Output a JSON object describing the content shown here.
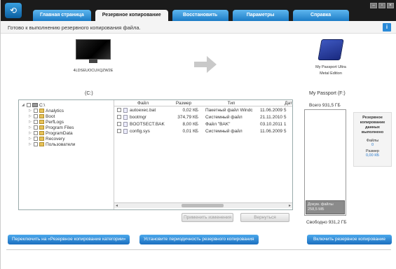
{
  "nav": {
    "tabs": [
      {
        "label": "Главная страница"
      },
      {
        "label": "Резервное копирование"
      },
      {
        "label": "Восстановить"
      },
      {
        "label": "Параметры"
      },
      {
        "label": "Справка"
      }
    ]
  },
  "status": {
    "text": "Готово к выполнению резервного копирования файла."
  },
  "info_icon": {
    "glyph": "i"
  },
  "source": {
    "device_name": "4LDSEUOCUXQZW2E",
    "drive_label": "(C:)"
  },
  "destination": {
    "device_name_line1": "My Passport Ultra",
    "device_name_line2": "Metal Edition",
    "drive_label": "My Passport (F:)"
  },
  "tree": {
    "root": "C:\\",
    "folders": [
      "Analytics",
      "Boot",
      "PerfLogs",
      "Program Files",
      "ProgramData",
      "Recovery",
      "Пользователи"
    ]
  },
  "files": {
    "columns": [
      "Файл",
      "Размер",
      "Тип",
      "Дат"
    ],
    "rows": [
      {
        "name": "autoexec.bat",
        "size": "0,02 КБ",
        "type": "Пакетный файл Windc",
        "date": "11.06.2009 5"
      },
      {
        "name": "bootmgr",
        "size": "374,79 КБ",
        "type": "Системный файл",
        "date": "21.11.2010 5"
      },
      {
        "name": "BOOTSECT.BAK",
        "size": "8,00 КБ",
        "type": "Файл \"BAK\"",
        "date": "03.10.2011 1"
      },
      {
        "name": "config.sys",
        "size": "0,01 КБ",
        "type": "Системный файл",
        "date": "11.06.2009 5"
      }
    ]
  },
  "actions": {
    "apply": "Применить изменения",
    "revert": "Вернуться"
  },
  "capacity": {
    "total": "Всего 931,5 ГБ",
    "used_line1": "Докум. файлы",
    "used_line2": "258,5 МБ",
    "free": "Свободно 931,2 ГБ"
  },
  "summary": {
    "title": "Резервное копирование данных выполнено",
    "files_label": "Файлы",
    "files_value": "0",
    "size_label": "Размер",
    "size_value": "0,00 КБ"
  },
  "bottom": {
    "switch_categories": "Переключить на «Резервное копирование категории»",
    "set_frequency": "Установите периодичность резервного копирования",
    "enable_backup": "Включить резервное копирование"
  },
  "colors": {
    "accent": "#1c7cc6",
    "topbar": "#1b1b1b"
  }
}
